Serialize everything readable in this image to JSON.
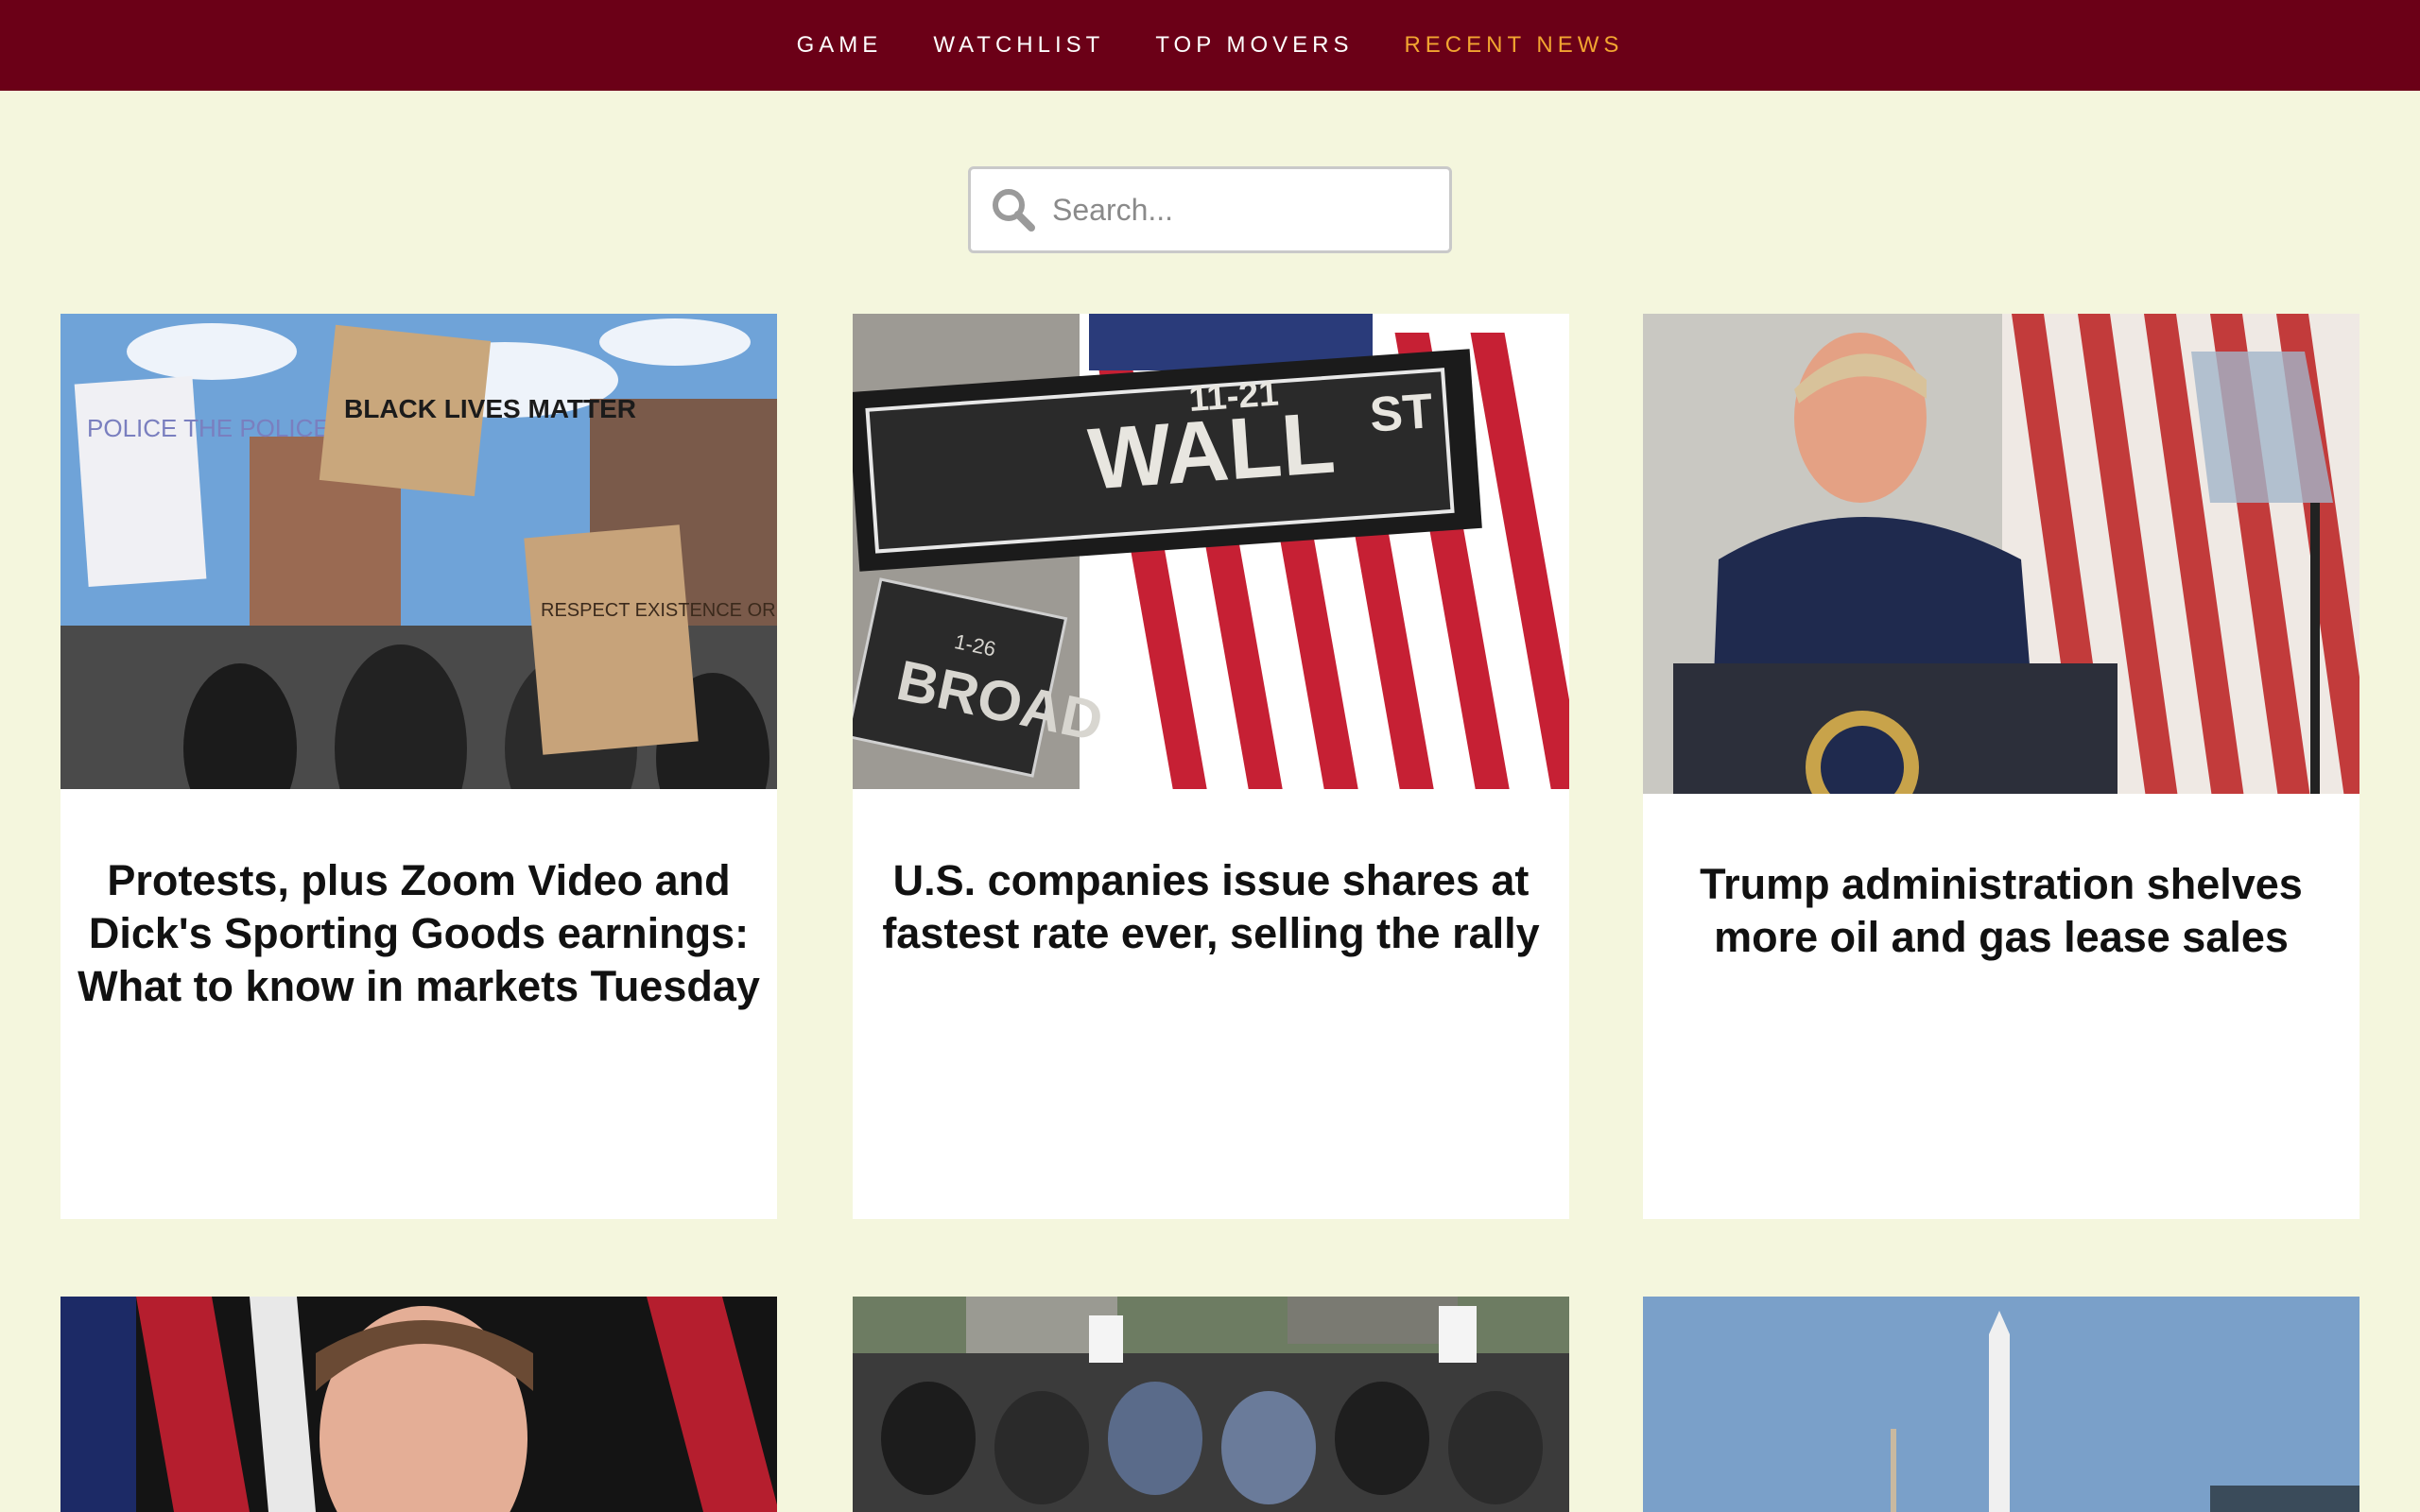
{
  "nav": {
    "items": [
      {
        "label": "GAME"
      },
      {
        "label": "WATCHLIST"
      },
      {
        "label": "TOP MOVERS"
      },
      {
        "label": "RECENT NEWS"
      }
    ]
  },
  "search": {
    "placeholder": "Search..."
  },
  "articles": [
    {
      "headline": "Protests, plus Zoom Video and Dick's Sporting Goods earnings: What to know in markets Tuesday",
      "image": {
        "signs": [
          "POLICE THE POLICE",
          "BLACK LIVES MATTER",
          "RESPECT EXISTENCE OR EXPECT RESISTANCE"
        ]
      }
    },
    {
      "headline": "U.S. companies issue shares at fastest rate ever, selling the rally",
      "image": {
        "sign_main": "WALL",
        "sign_st": "ST",
        "sign_num": "11-21",
        "sign_side": "BROAD",
        "sign_side_num": "1-26"
      }
    },
    {
      "headline": "Trump administration shelves more oil and gas lease sales",
      "image": {}
    },
    {
      "headline": "",
      "image": {}
    },
    {
      "headline": "",
      "image": {}
    },
    {
      "headline": "",
      "image": {}
    }
  ],
  "colors": {
    "nav_bg": "#6b0017",
    "nav_active": "#f2a531",
    "page_bg": "#f4f6dd"
  }
}
